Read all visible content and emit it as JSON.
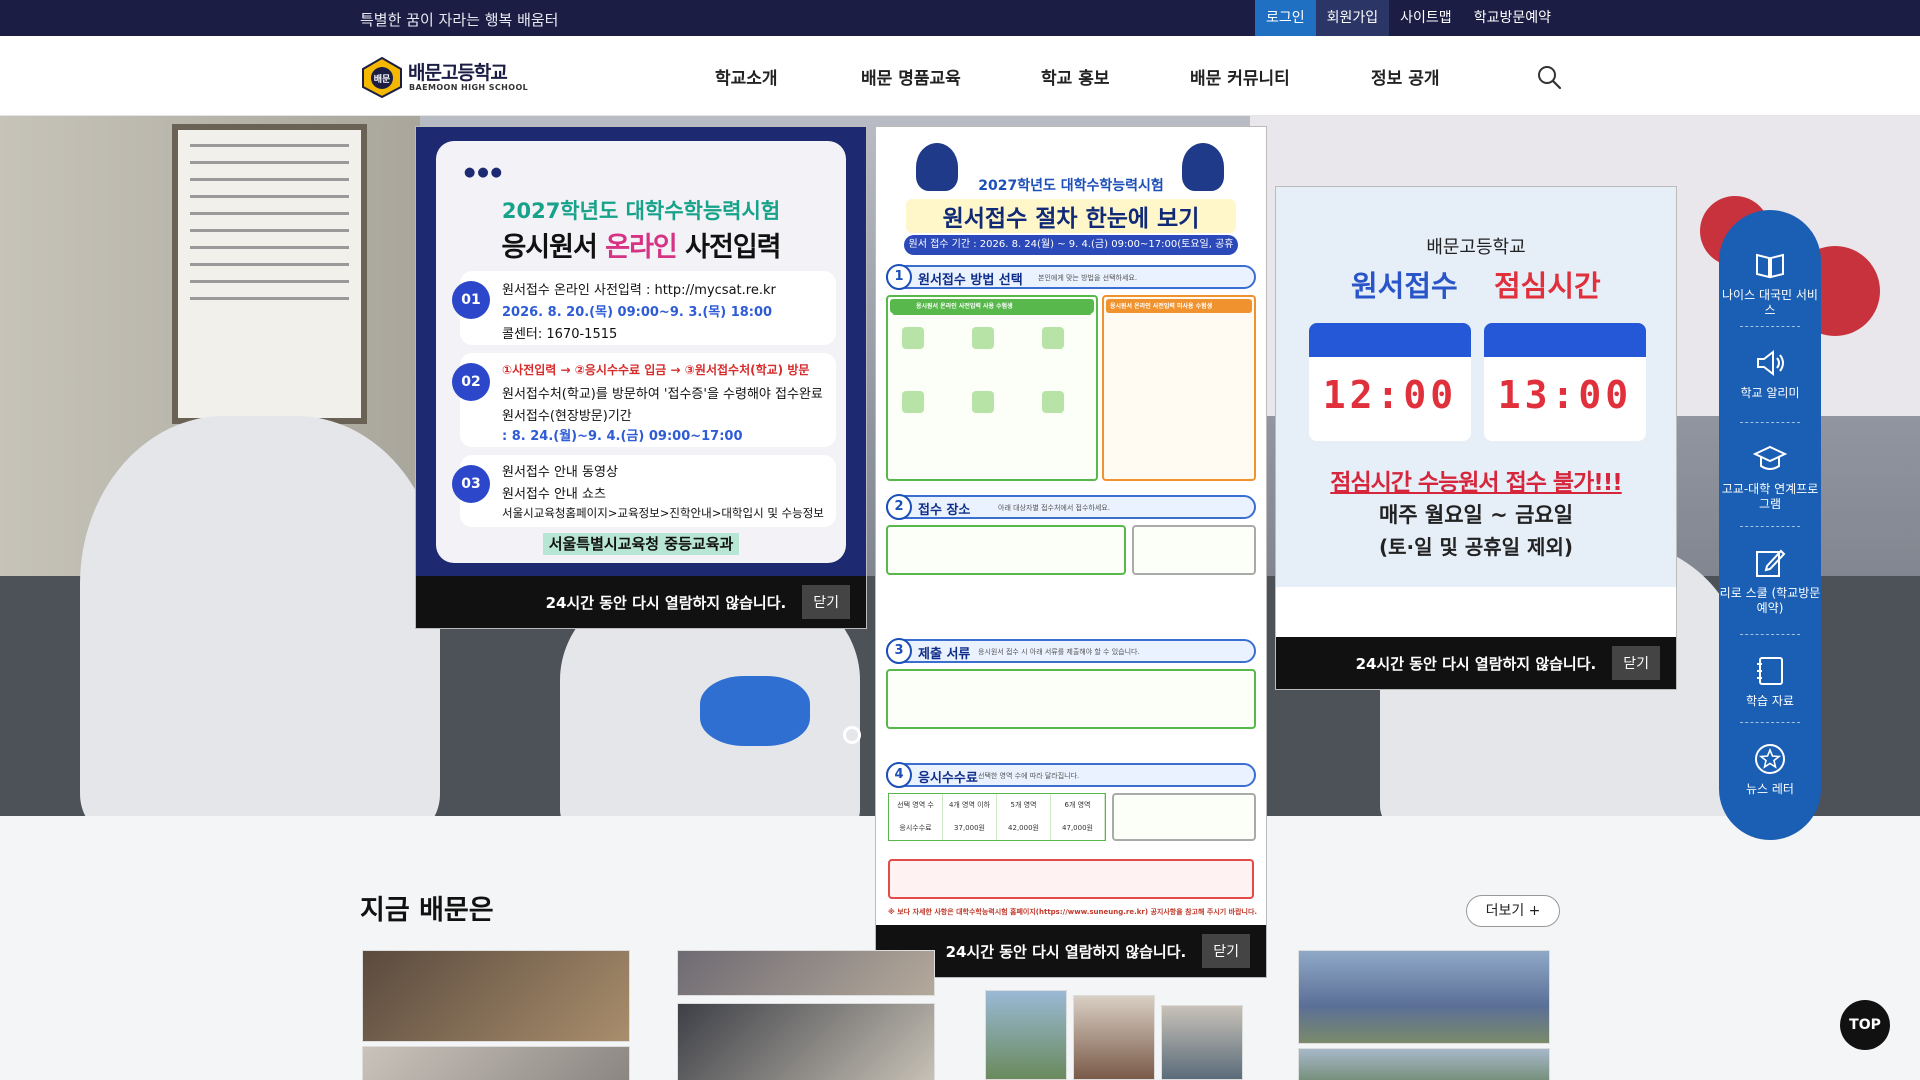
{
  "topbar": {
    "slogan": "특별한 꿈이 자라는 행복 배움터",
    "links": [
      "로그인",
      "회원가입",
      "사이트맵",
      "학교방문예약"
    ]
  },
  "header": {
    "logo_name": "배문고등학교",
    "logo_eng": "BAEMOON HIGH SCHOOL",
    "logo_badge": "배문",
    "nav": [
      "학교소개",
      "배문 명품교육",
      "학교 홍보",
      "배문 커뮤니티",
      "정보 공개"
    ]
  },
  "popup1": {
    "title1": "2027학년도 대학수학능력시험",
    "title2_pre": "응시원서 ",
    "title2_hl": "온라인",
    "title2_post": " 사전입력",
    "steps": [
      {
        "num": "01",
        "lines": [
          "원서접수 온라인 사전입력 : http://mycsat.re.kr",
          "2026. 8. 20.(목) 09:00~9. 3.(목) 18:00",
          "콜센터: 1670-1515"
        ]
      },
      {
        "num": "02",
        "lines": [
          "①사전입력 → ②응시수수료 입금 → ③원서접수처(학교) 방문",
          "원서접수처(학교)를 방문하여 '접수증'을 수령해야 접수완료",
          "원서접수(현장방문)기간",
          " : 8. 24.(월)~9. 4.(금) 09:00~17:00"
        ]
      },
      {
        "num": "03",
        "lines": [
          "원서접수 안내 동영상",
          "원서접수 안내 쇼츠",
          "서울시교육청홈페이지>교육정보>진학안내>대학입시 및 수능정보"
        ]
      }
    ],
    "source": "서울특별시교육청 중등교육과",
    "no_show": "24시간 동안 다시 열람하지 않습니다.",
    "close": "닫기"
  },
  "popup2": {
    "heading1": "2027학년도 대학수학능력시험",
    "heading2": "원서접수 절차 한눈에 보기",
    "period": "원서 접수 기간 : 2026. 8. 24(월) ~ 9. 4.(금) 09:00~17:00(토요일, 공휴일 제외)",
    "sections": [
      {
        "n": "1",
        "label": "원서접수 방법 선택",
        "sub": "본인에게 맞는 방법을 선택하세요."
      },
      {
        "n": "2",
        "label": "접수 장소",
        "sub": "아래 대상자별 접수처에서 접수하세요."
      },
      {
        "n": "3",
        "label": "제출 서류",
        "sub": "응시원서 접수 시 아래 서류를 제출해야 할 수 있습니다."
      },
      {
        "n": "4",
        "label": "응시수수료",
        "sub": "선택한 영역 수에 따라 달라집니다."
      }
    ],
    "method_online": "응시원서 온라인 사전입력 사용 수험생",
    "method_offline": "응시원서 온라인 사전입력 미사용 수험생",
    "fee_head": [
      "선택 영역 수",
      "4개 영역 이하",
      "5개 영역",
      "6개 영역"
    ],
    "fee_row": [
      "응시수수료",
      "37,000원",
      "42,000원",
      "47,000원"
    ],
    "footnote": "※ 보다 자세한 사항은 대학수학능력시험 홈페이지(https://www.suneung.re.kr) 공지사항을 참고해 주시기 바랍니다.",
    "no_show": "24시간 동안 다시 열람하지 않습니다.",
    "close": "닫기"
  },
  "popup3": {
    "school": "배문고등학교",
    "title_left": "원서접수",
    "title_right": "점심시간",
    "time_left": "12:00",
    "time_right": "13:00",
    "warning": "점심시간 수능원서 접수 불가!!!",
    "days": "매주 월요일 ~ 금요일",
    "except": "(토·일 및 공휴일 제외)",
    "no_show": "24시간 동안 다시 열람하지 않습니다.",
    "close": "닫기"
  },
  "quick_menu": [
    {
      "icon": "book-icon",
      "label": "나이스 대국민 서비스"
    },
    {
      "icon": "megaphone-icon",
      "label": "학교 알리미"
    },
    {
      "icon": "graduation-cap-icon",
      "label": "고교-대학 연계프로그램"
    },
    {
      "icon": "edit-icon",
      "label": "리로 스쿨 (학교방문예약)"
    },
    {
      "icon": "notebook-icon",
      "label": "학습 자료"
    },
    {
      "icon": "star-badge-icon",
      "label": "뉴스 레터"
    }
  ],
  "top_button": "TOP",
  "news": {
    "title": "지금 배문은",
    "more": "더보기 +"
  },
  "colors": {
    "topbar": "#1b1d44",
    "accent": "#1a5fb4",
    "login": "#1f6fc2"
  }
}
